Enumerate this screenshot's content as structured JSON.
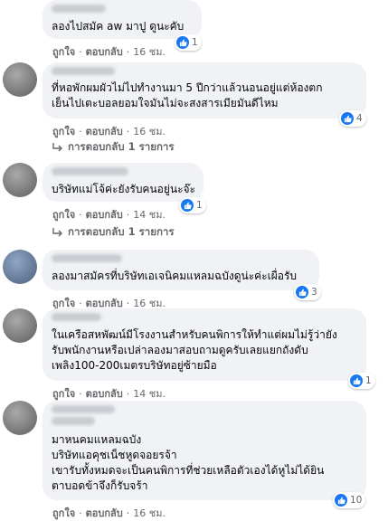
{
  "colors": {
    "accent": "#1877f2",
    "bubble": "#f0f2f5",
    "meta": "#65676b"
  },
  "actions": {
    "like": "ถูกใจ",
    "reply": "ตอบกลับ",
    "dot": "·"
  },
  "comments": [
    {
      "text": "ลองไปสมัค aw มาปู ดูนะคับ",
      "reactions": "1",
      "time": "16 ชม."
    },
    {
      "text": "ที่หอพักผมผัวไม่ไปทำงานมา 5 ปีกว่าแล้วนอนอยู่แต่ห้องตก\nเย็นไปเตะบอลยอมใจมันไม่จะสงสารเมียมันดีไหม",
      "reactions": "4",
      "time": "16 ชม.",
      "replies": "การตอบกลับ 1 รายการ"
    },
    {
      "text": "บริษัทแม่โจ้ค่ะยังรับคนอยู่นะจ๊ะ",
      "reactions": "1",
      "time": "14 ชม.",
      "replies": "การตอบกลับ 1 รายการ"
    },
    {
      "text": "ลองมาสมัครที่บริษัทเอเจนิคมแหลมฉบังดูน่ะค่ะเผื่อรับ",
      "reactions": "3",
      "time": "16 ชม."
    },
    {
      "text": "ในเครือสหพัฒน์มีโรงงานสำหรับคนพิการให้ทำแต่ผมไม่รู้ว่ายัง\nรับพนักงานหรือเปล่าลองมาสอบถามดูครับเลยแยกถังดับ\nเพลิง100-200เมตรบริษัทอยู่ซ้ายมือ",
      "reactions": "1",
      "time": "14 ชม."
    },
    {
      "text": "มาหนคมแหลมฉบัง\nบริษัทแอคุชเน็ชหูดจอยรจ้า\nเขารับทั้งหมดจะเป็นคนพิการที่ช่วยเหลือตัวเองได้หูไม่ได้ยิน\nตาบอดข้าจึงก็รับจร้า",
      "reactions": "10",
      "time": "16 ชม."
    }
  ]
}
